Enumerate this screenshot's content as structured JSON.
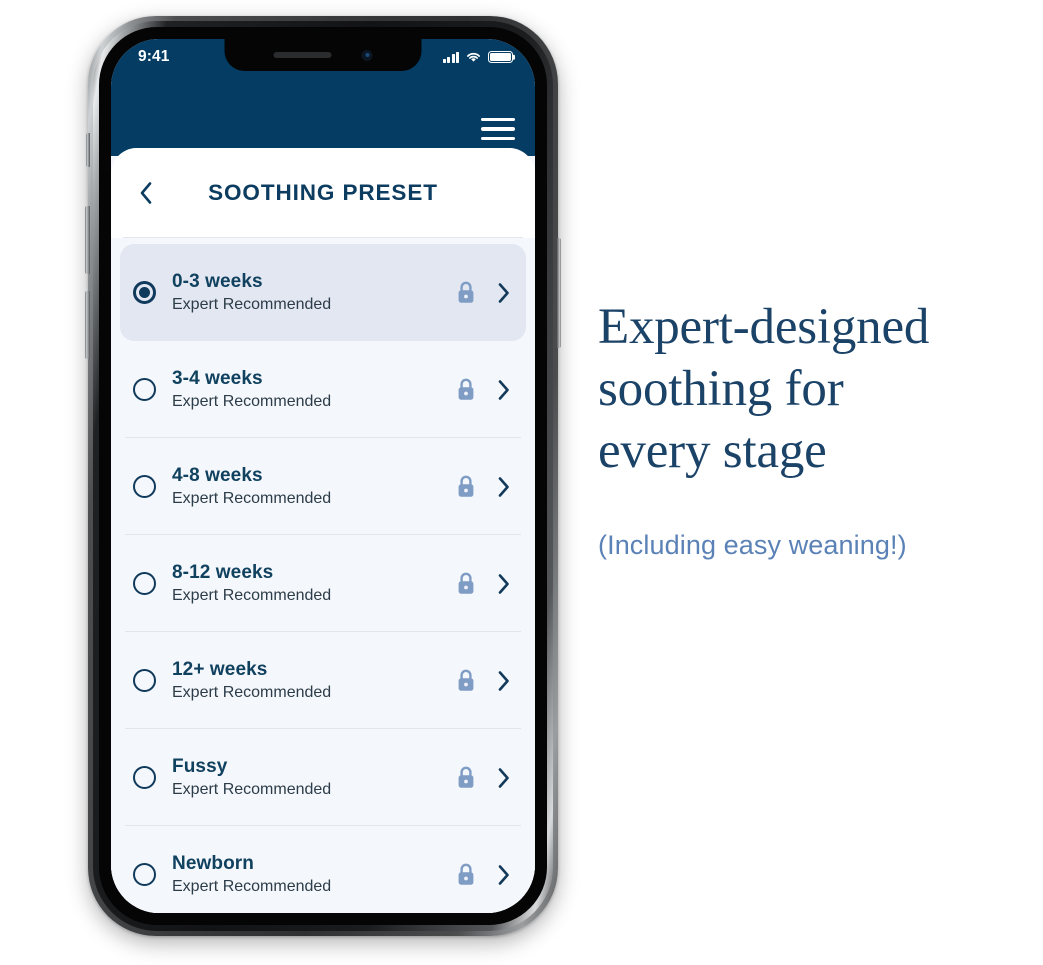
{
  "device": {
    "status_bar": {
      "time": "9:41",
      "cellular_icon": "signal-bars-icon",
      "wifi_icon": "wifi-icon",
      "battery_icon": "battery-full-icon"
    }
  },
  "app": {
    "navbar": {
      "menu_icon": "hamburger-menu-icon",
      "background_color": "#043c64"
    },
    "header": {
      "back_icon": "chevron-left-icon",
      "title": "SOOTHING PRESET"
    },
    "list": {
      "lock_icon": "lock-icon",
      "disclosure_icon": "chevron-right-icon",
      "items": [
        {
          "name": "0-3 weeks",
          "subtitle": "Expert Recommended",
          "selected": true
        },
        {
          "name": "3-4 weeks",
          "subtitle": "Expert Recommended",
          "selected": false
        },
        {
          "name": "4-8 weeks",
          "subtitle": "Expert Recommended",
          "selected": false
        },
        {
          "name": "8-12 weeks",
          "subtitle": "Expert Recommended",
          "selected": false
        },
        {
          "name": "12+ weeks",
          "subtitle": "Expert Recommended",
          "selected": false
        },
        {
          "name": "Fussy",
          "subtitle": "Expert Recommended",
          "selected": false
        },
        {
          "name": "Newborn",
          "subtitle": "Expert Recommended",
          "selected": false
        }
      ]
    }
  },
  "marketing": {
    "headline": "Expert-designed\nsoothing for\nevery stage",
    "subhead": "(Including easy weaning!)",
    "headline_color": "#1b4267",
    "subhead_color": "#5b82b6"
  },
  "theme": {
    "navy": "#043c64",
    "title_navy": "#0c3c60",
    "row_selected_bg": "#e3e7f2",
    "row_bg": "#f4f7fb",
    "lock_blue": "#7f9cc4",
    "page_bg": "#ffffff"
  }
}
